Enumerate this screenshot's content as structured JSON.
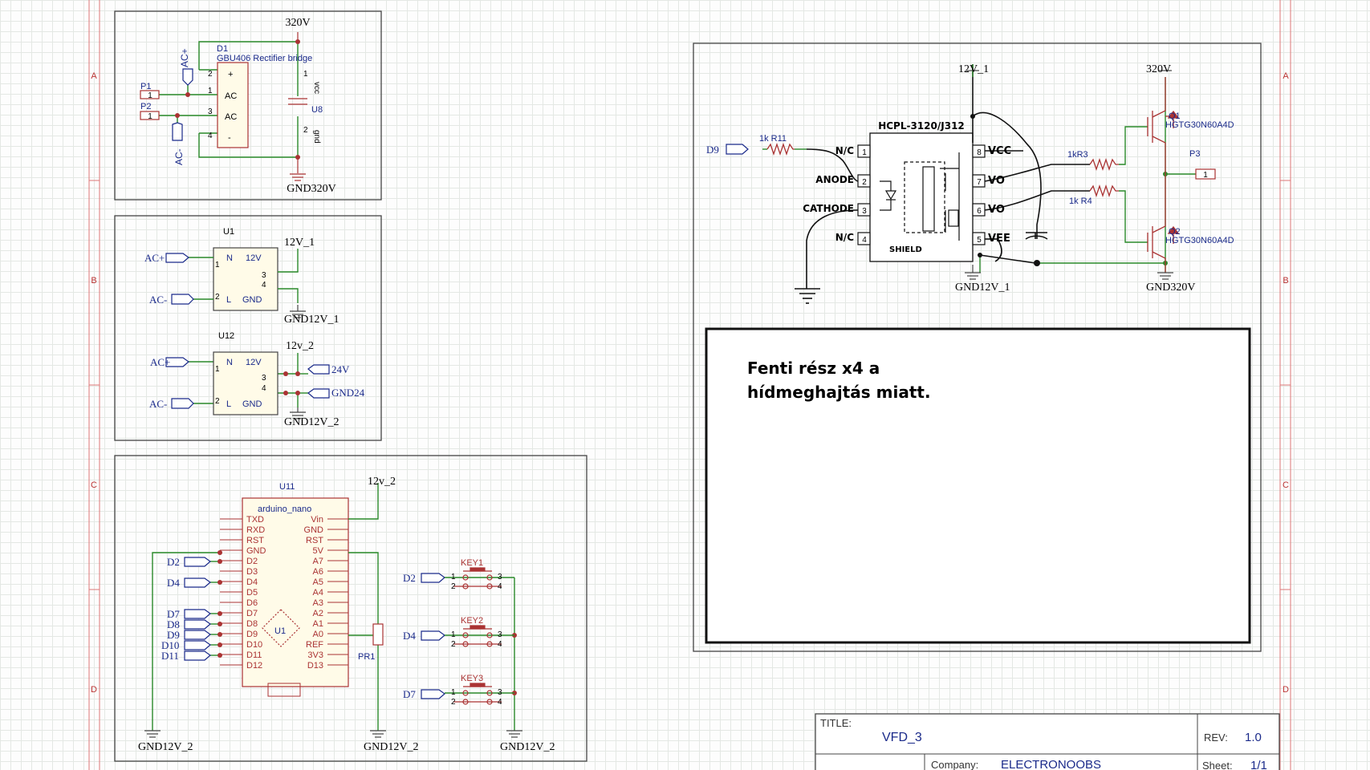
{
  "sheet": {
    "border_letters": [
      "A",
      "B",
      "C",
      "D"
    ],
    "title_block": {
      "title_label": "TITLE:",
      "title": "VFD_3",
      "rev_label": "REV:",
      "rev": "1.0",
      "company_label": "Company:",
      "company": "ELECTRONOOBS",
      "sheet_label": "Sheet:",
      "sheet": "1/1"
    }
  },
  "rectifier": {
    "designator": "D1",
    "part": "GBU406 Rectifier bridge",
    "vcc_net": "320V",
    "gnd_net": "GND320V",
    "ports": [
      "AC+",
      "AC-"
    ],
    "connectors": [
      "P1",
      "P2"
    ],
    "pin_labels": [
      "+",
      "AC",
      "AC",
      "-"
    ],
    "pin_numbers": [
      "2",
      "1",
      "3",
      "4"
    ],
    "cap": {
      "designator": "U8",
      "pin_vcc": "vcc",
      "pin_gnd": "gnd",
      "pin1": "1",
      "pin2": "2"
    }
  },
  "psu1": {
    "designator": "U1",
    "pins": [
      "N",
      "L",
      "12V",
      "GND"
    ],
    "pin_numbers": [
      "1",
      "2",
      "3",
      "4"
    ],
    "inputs": [
      "AC+",
      "AC-"
    ],
    "out_net": "12V_1",
    "gnd_net": "GND12V_1"
  },
  "psu2": {
    "designator": "U12",
    "pins": [
      "N",
      "L",
      "12V",
      "GND"
    ],
    "pin_numbers": [
      "1",
      "2",
      "3",
      "4"
    ],
    "inputs": [
      "AC+",
      "AC-"
    ],
    "out_net": "12v_2",
    "gnd_net": "GND12V_2",
    "ports": [
      "24V",
      "GND24"
    ]
  },
  "mcu": {
    "designator": "U11",
    "part": "arduino_nano",
    "chip_label": "U1",
    "left_pins": [
      "TXD",
      "RXD",
      "RST",
      "GND",
      "D2",
      "D3",
      "D4",
      "D5",
      "D6",
      "D7",
      "D8",
      "D9",
      "D10",
      "D11",
      "D12"
    ],
    "right_pins": [
      "Vin",
      "GND",
      "RST",
      "5V",
      "A7",
      "A6",
      "A5",
      "A4",
      "A3",
      "A2",
      "A1",
      "A0",
      "REF",
      "3V3",
      "D13"
    ],
    "ports": [
      "D2",
      "D4",
      "D7",
      "D8",
      "D9",
      "D10",
      "D11"
    ],
    "pot": "PR1",
    "net_top": "12v_2",
    "gnd_nets": [
      "GND12V_2",
      "GND12V_2",
      "GND12V_2"
    ],
    "keys": [
      {
        "name": "KEY1",
        "port": "D2"
      },
      {
        "name": "KEY2",
        "port": "D4"
      },
      {
        "name": "KEY3",
        "port": "D7"
      }
    ],
    "key_pins": [
      "1",
      "2",
      "3",
      "4"
    ]
  },
  "driver": {
    "ic": "HCPL-3120/J312",
    "pins_left": [
      {
        "num": "1",
        "name": "N/C"
      },
      {
        "num": "2",
        "name": "ANODE"
      },
      {
        "num": "3",
        "name": "CATHODE"
      },
      {
        "num": "4",
        "name": "N/C"
      }
    ],
    "pins_right": [
      {
        "num": "8",
        "name": "VCC"
      },
      {
        "num": "7",
        "name": "VO"
      },
      {
        "num": "6",
        "name": "VO"
      },
      {
        "num": "5",
        "name": "VEE"
      }
    ],
    "shield": "SHIELD",
    "input_port": "D9",
    "r11": "1k R11",
    "r3": "1kR3",
    "r4": "1k R4",
    "net_vcc": "12V_1",
    "net_gnd": "GND12V_1",
    "net_hv": "320V",
    "net_hv_gnd": "GND320V",
    "q1": {
      "designator": "Q1",
      "part": "HGTG30N60A4D"
    },
    "q2": {
      "designator": "Q2",
      "part": "HGTG30N60A4D"
    },
    "output": {
      "designator": "P3",
      "pin": "1"
    }
  },
  "note": {
    "line1": "Fenti rész x4 a",
    "line2": "hídmeghajtás miatt."
  }
}
